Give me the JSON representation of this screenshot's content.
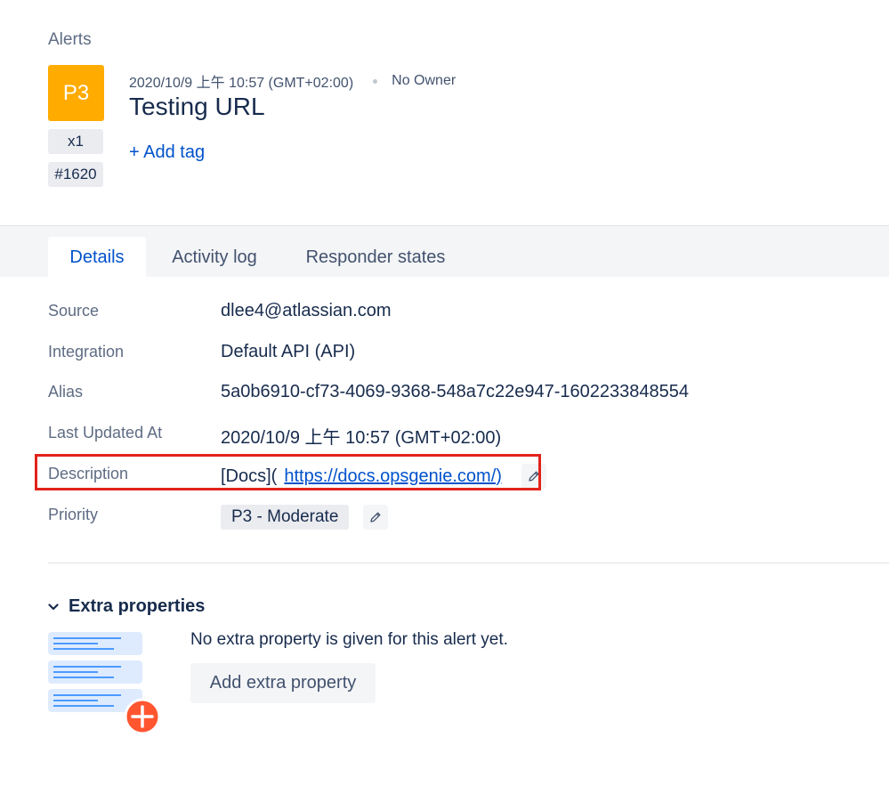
{
  "breadcrumb": "Alerts",
  "alert": {
    "priority": "P3",
    "count": "x1",
    "tiny_id": "#1620",
    "created_at": "2020/10/9 上午 10:57 (GMT+02:00)",
    "owner": "No Owner",
    "title": "Testing URL",
    "add_tag_label": "+ Add tag",
    "priority_color": "#ffab00"
  },
  "tabs": [
    {
      "label": "Details",
      "active": true
    },
    {
      "label": "Activity log",
      "active": false
    },
    {
      "label": "Responder states",
      "active": false
    }
  ],
  "details": {
    "source": {
      "label": "Source",
      "value": "dlee4@atlassian.com"
    },
    "integration": {
      "label": "Integration",
      "value": "Default API (API)"
    },
    "alias": {
      "label": "Alias",
      "value": "5a0b6910-cf73-4069-9368-548a7c22e947-1602233848554"
    },
    "last_updated": {
      "label": "Last Updated At",
      "value": "2020/10/9 上午 10:57 (GMT+02:00)"
    },
    "description": {
      "label": "Description",
      "prefix": "[Docs](",
      "link": "https://docs.opsgenie.com/)"
    },
    "priority": {
      "label": "Priority",
      "value": "P3 - Moderate"
    }
  },
  "extra_properties": {
    "header": "Extra properties",
    "empty_message": "No extra property is given for this alert yet.",
    "add_button": "Add extra property"
  },
  "icons": {
    "edit": "pencil-icon",
    "chevron": "chevron-down-icon",
    "illustration": "list-add-illustration"
  },
  "colors": {
    "link": "#0052cc",
    "highlight": "#e2231a",
    "add_circle": "#ff5630"
  }
}
